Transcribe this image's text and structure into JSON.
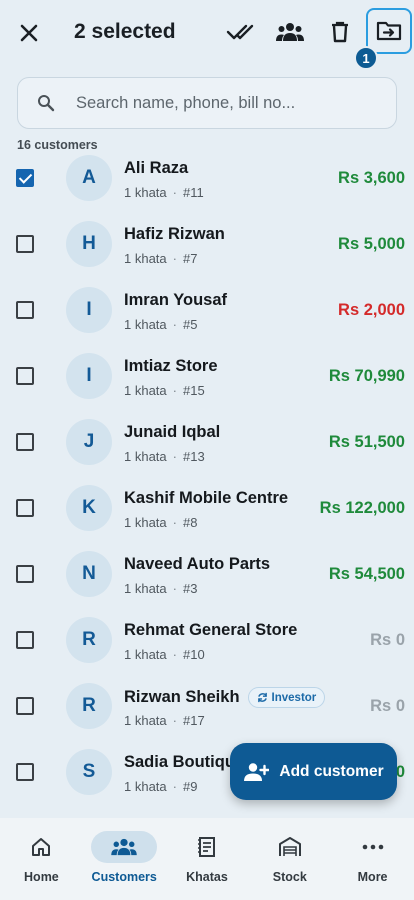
{
  "header": {
    "title": "2 selected",
    "badge_count": "1",
    "icons": [
      "close-icon",
      "double-check-icon",
      "group-icon",
      "trash-icon",
      "move-to-folder-icon"
    ]
  },
  "search": {
    "placeholder": "Search name, phone, bill no..."
  },
  "list": {
    "count_label": "16 customers",
    "customers": [
      {
        "initial": "A",
        "name": "Ali Raza",
        "khata": "1 khata",
        "number": "#11",
        "amount": "Rs 3,600",
        "status": "green",
        "checked": true
      },
      {
        "initial": "H",
        "name": "Hafiz Rizwan",
        "khata": "1 khata",
        "number": "#7",
        "amount": "Rs 5,000",
        "status": "green",
        "checked": false
      },
      {
        "initial": "I",
        "name": "Imran Yousaf",
        "khata": "1 khata",
        "number": "#5",
        "amount": "Rs 2,000",
        "status": "red",
        "checked": false
      },
      {
        "initial": "I",
        "name": "Imtiaz Store",
        "khata": "1 khata",
        "number": "#15",
        "amount": "Rs 70,990",
        "status": "green",
        "checked": false
      },
      {
        "initial": "J",
        "name": "Junaid Iqbal",
        "khata": "1 khata",
        "number": "#13",
        "amount": "Rs 51,500",
        "status": "green",
        "checked": false
      },
      {
        "initial": "K",
        "name": "Kashif Mobile Centre",
        "khata": "1 khata",
        "number": "#8",
        "amount": "Rs 122,000",
        "status": "green",
        "checked": false
      },
      {
        "initial": "N",
        "name": "Naveed Auto Parts",
        "khata": "1 khata",
        "number": "#3",
        "amount": "Rs 54,500",
        "status": "green",
        "checked": false
      },
      {
        "initial": "R",
        "name": "Rehmat General Store",
        "khata": "1 khata",
        "number": "#10",
        "amount": "Rs 0",
        "status": "grey",
        "checked": false
      },
      {
        "initial": "R",
        "name": "Rizwan Sheikh",
        "tag": "Investor",
        "khata": "1 khata",
        "number": "#17",
        "amount": "Rs 0",
        "status": "grey",
        "checked": false
      },
      {
        "initial": "S",
        "name": "Sadia Boutique",
        "khata": "1 khata",
        "number": "#9",
        "amount": "Rs 0",
        "status": "green",
        "checked": false
      }
    ]
  },
  "fab": {
    "label": "Add customer"
  },
  "nav": {
    "items": [
      {
        "label": "Home",
        "icon": "home-icon",
        "active": false
      },
      {
        "label": "Customers",
        "icon": "customers-icon",
        "active": true
      },
      {
        "label": "Khatas",
        "icon": "ledger-icon",
        "active": false
      },
      {
        "label": "Stock",
        "icon": "warehouse-icon",
        "active": false
      },
      {
        "label": "More",
        "icon": "more-icon",
        "active": false
      }
    ]
  },
  "colors": {
    "accent": "#0e5a94",
    "positive": "#1f8a3b",
    "negative": "#d42a2a",
    "zero": "#9aa3aa",
    "background": "#e6eef4"
  }
}
